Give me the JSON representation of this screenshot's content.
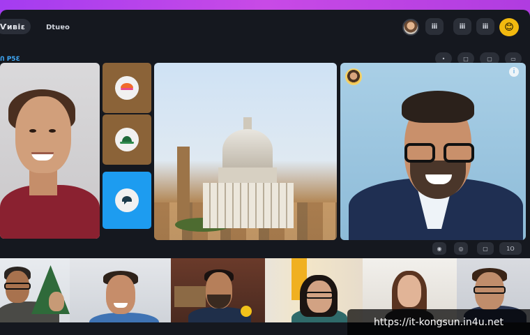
{
  "header": {
    "logo_text": "Ѵивіε",
    "app_title": "Dtuɐo",
    "buttons": [
      "ⅲ",
      "ⅲ",
      "ⅲ",
      "ⅲ"
    ],
    "emoji": "😊"
  },
  "subbar": {
    "label": "Ո Ρ5Ɛ",
    "buttons": [
      "•",
      "□",
      "▢",
      "▭"
    ]
  },
  "tiles": {
    "tile_badge": "i",
    "mid_controls": [
      "◉",
      "◎",
      "▢",
      "1O"
    ]
  },
  "watermark": "https://it-kongsun.in4u.net",
  "colors": {
    "frame": "#15181f",
    "accent_blue": "#1d9cf0",
    "side_brown": "#8b6338",
    "emoji_yellow": "#f2b90f"
  }
}
